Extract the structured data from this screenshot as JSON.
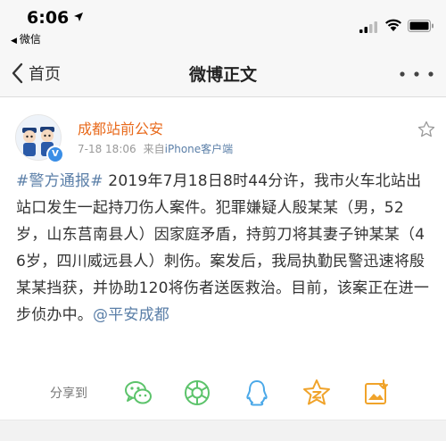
{
  "status_bar": {
    "time": "6:06",
    "back_app": "微信"
  },
  "navbar": {
    "back_label": "首页",
    "title": "微博正文"
  },
  "post": {
    "author": "成都站前公安",
    "verified_badge": "V",
    "date": "7-18 18:06",
    "source_prefix": "来自",
    "source_app": "iPhone客户端",
    "hashtag": "#警方通报#",
    "body": " 2019年7月18日8时44分许，我市火车北站出站口发生一起持刀伤人案件。犯罪嫌疑人殷某某（男，52岁，山东莒南县人）因家庭矛盾，持剪刀将其妻子钟某某（46岁，四川威远县人）刺伤。案发后，我局执勤民警迅速将殷某某挡获，并协助120将伤者送医救治。目前，该案正在进一步侦办中。",
    "mention": "@平安成都"
  },
  "share": {
    "label": "分享到",
    "targets": [
      "wechat-icon",
      "moments-icon",
      "qq-icon",
      "qzone-icon",
      "save-image-icon"
    ]
  },
  "colors": {
    "author": "#e86a1c",
    "link": "#5b7fa8",
    "share_green": "#5cc36b",
    "share_orange": "#f0a32a",
    "share_blue": "#4aa8e8"
  }
}
